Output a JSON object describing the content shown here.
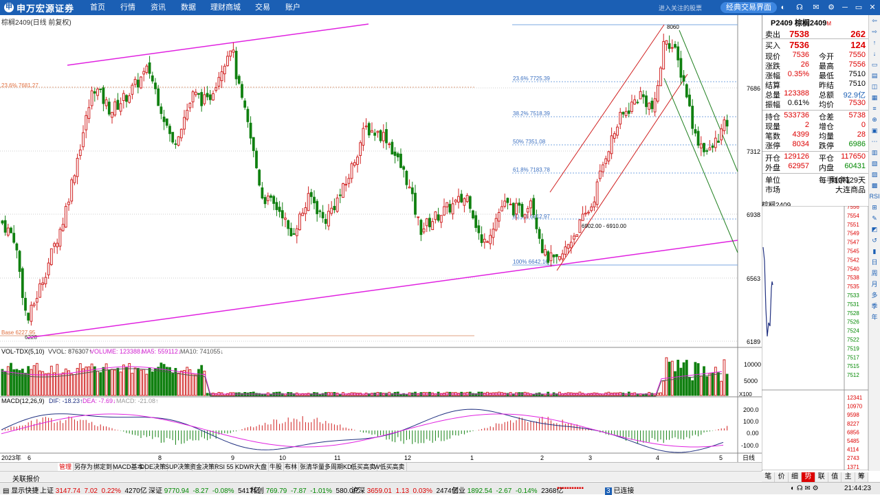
{
  "app": {
    "brand": "申万宏源证券",
    "nav": [
      "首页",
      "行情",
      "资讯",
      "数据",
      "理财商城",
      "交易",
      "账户"
    ],
    "hint": "进入关注的股票",
    "classic_button": "经典交易界面"
  },
  "chart": {
    "title": "棕榈2409(日线 前复权)",
    "price_ticks": [
      "7686",
      "7312",
      "6938",
      "6563",
      "6189"
    ],
    "fib_labels": [
      "23.6% 7725.39",
      "38.2% 7518.39",
      "50% 7351.08",
      "61.8% 7183.78",
      "80.9% 6912.97",
      "100% 6642.16"
    ],
    "left_fib_label": "23.6% 7681.27",
    "base_label": "Base 6227.95",
    "low_label": "6228",
    "high_label": "8060",
    "range_label": "6902.00 - 6910.00",
    "months": [
      "2023年",
      "6",
      "8",
      "9",
      "10",
      "11",
      "12",
      "1",
      "2",
      "3",
      "4",
      "5"
    ],
    "period_button": "日线",
    "vol_header": {
      "name": "VOL-TDX(5,10)",
      "vvol": "VVOL: 876307↑",
      "volume": "VOLUME: 123388↓",
      "ma5": "MA5: 559112↓",
      "ma10": "MA10: 741055↓"
    },
    "vol_ticks": [
      "10000",
      "5000",
      "X100"
    ],
    "macd_header": {
      "name": "MACD(12,26,9)",
      "dif": "DIF: -18.23↑",
      "dea": "DEA: -7.69↓",
      "macd": "MACD: -21.08↑"
    },
    "macd_ticks": [
      "200.0",
      "100.0",
      "0.00",
      "-100.0"
    ]
  },
  "chart_data": {
    "type": "candlestick",
    "title": "棕榈2409(日线 前复权)",
    "series_summary": {
      "low": 6228,
      "high": 8060,
      "last": 7536
    },
    "fibonacci": [
      {
        "level": "23.6%",
        "price": 7725.39
      },
      {
        "level": "38.2%",
        "price": 7518.39
      },
      {
        "level": "50%",
        "price": 7351.08
      },
      {
        "level": "61.8%",
        "price": 7183.78
      },
      {
        "level": "80.9%",
        "price": 6912.97
      },
      {
        "level": "100%",
        "price": 6642.16
      }
    ],
    "ylim": [
      6150,
      8080
    ]
  },
  "quote": {
    "symbol": "P2409 棕榈2409",
    "rows": [
      {
        "k": "卖出",
        "v": "7538",
        "k2": "",
        "v2": "262",
        "cls": "red big",
        "cls2": "red big"
      },
      {
        "k": "买入",
        "v": "7536",
        "k2": "",
        "v2": "124",
        "cls": "red big",
        "cls2": "red big"
      },
      {
        "k": "现价",
        "v": "7536",
        "k2": "今开",
        "v2": "7550",
        "cls": "red",
        "cls2": "red"
      },
      {
        "k": "涨跌",
        "v": "26",
        "k2": "最高",
        "v2": "7556",
        "cls": "red",
        "cls2": "red"
      },
      {
        "k": "涨幅",
        "v": "0.35%",
        "k2": "最低",
        "v2": "7510",
        "cls": "red",
        "cls2": ""
      },
      {
        "k": "结算",
        "v": "",
        "k2": "昨结",
        "v2": "7510",
        "cls": "",
        "cls2": ""
      },
      {
        "k": "总量",
        "v": "123388",
        "k2": "总额",
        "v2": "92.9亿",
        "cls": "red",
        "cls2": "blue"
      },
      {
        "k": "振幅",
        "v": "0.61%",
        "k2": "均价",
        "v2": "7530",
        "cls": "",
        "cls2": "red"
      },
      {
        "k": "持仓",
        "v": "533736",
        "k2": "仓差",
        "v2": "5738",
        "cls": "red",
        "cls2": "red"
      },
      {
        "k": "现量",
        "v": "2",
        "k2": "增仓",
        "v2": "0",
        "cls": "red",
        "cls2": "red"
      },
      {
        "k": "笔数",
        "v": "4399",
        "k2": "均量",
        "v2": "28",
        "cls": "red",
        "cls2": "red"
      },
      {
        "k": "涨停",
        "v": "8034",
        "k2": "跌停",
        "v2": "6986",
        "cls": "red",
        "cls2": "green"
      },
      {
        "k": "开仓",
        "v": "129126",
        "k2": "平仓",
        "v2": "117650",
        "cls": "red",
        "cls2": "red"
      },
      {
        "k": "外盘",
        "v": "62957",
        "k2": "内盘",
        "v2": "60431",
        "cls": "red",
        "cls2": "green"
      },
      {
        "k": "单位",
        "v": "",
        "k2": "每手10吨",
        "v2": "剩余129天",
        "cls": "",
        "cls2": ""
      },
      {
        "k": "市场",
        "v": "",
        "k2": "",
        "v2": "大连商品",
        "cls": "",
        "cls2": ""
      }
    ],
    "mini_title": "棕榈2409",
    "mini_prices": [
      "7556",
      "7554",
      "7551",
      "7549",
      "7547",
      "7545",
      "7542",
      "7540",
      "7538",
      "7535",
      "7533",
      "7531",
      "7528",
      "7526",
      "7524",
      "7522",
      "7519",
      "7517",
      "7515",
      "7512",
      "12341",
      "10970",
      "9598",
      "8227",
      "6856",
      "5485",
      "4114",
      "2743",
      "1371"
    ],
    "bottom_tabs": [
      "笔",
      "价",
      "细",
      "势",
      "联",
      "值",
      "主",
      "筹"
    ],
    "active_bottom_tab": "势"
  },
  "strip_icons": [
    "⇦",
    "⇨",
    "↑",
    "↓",
    "▭",
    "▤",
    "◫",
    "▦",
    "≡",
    "⊕",
    "▣",
    "⋯",
    "▥",
    "▧",
    "▨",
    "▩",
    "RSI",
    "⊞",
    "✎",
    "◩",
    "↺",
    "▮",
    "日",
    "周",
    "月",
    "多",
    "季",
    "年"
  ],
  "tabs": [
    "管理",
    "另存为",
    "绑定到",
    "MACD基本",
    "DDE决策",
    "SUP决策",
    "资金决策",
    "RSI 55",
    "KDWR",
    "大盘",
    "牛股",
    "布林",
    "张清华量",
    "多周期KD",
    "低买高卖",
    "W低买高卖"
  ],
  "active_tab": "管理",
  "bar2_label": "关联报价",
  "status": {
    "left": "显示快捷",
    "sh_name": "上证",
    "sh_val": "3147.74",
    "sh_chg": "7.02",
    "sh_pct": "0.22%",
    "sh_amt": "4270亿",
    "sz_name": "深证",
    "sz_val": "9770.94",
    "sz_chg": "-8.27",
    "sz_pct": "-0.08%",
    "sz_amt": "5417亿",
    "kc_name": "科创",
    "kc_val": "769.79",
    "kc_chg": "-7.87",
    "kc_pct": "-1.01%",
    "kc_amt": "580.0亿",
    "hs_name": "沪深",
    "hs_val": "3659.01",
    "hs_chg": "1.13",
    "hs_pct": "0.03%",
    "hs_amt": "2474亿",
    "cy_name": "创业",
    "cy_val": "1892.54",
    "cy_chg": "-2.67",
    "cy_pct": "-0.14%",
    "cy_amt": "2368亿",
    "conn_count": "3",
    "conn_text": "已连接",
    "time": "21:44:23"
  }
}
